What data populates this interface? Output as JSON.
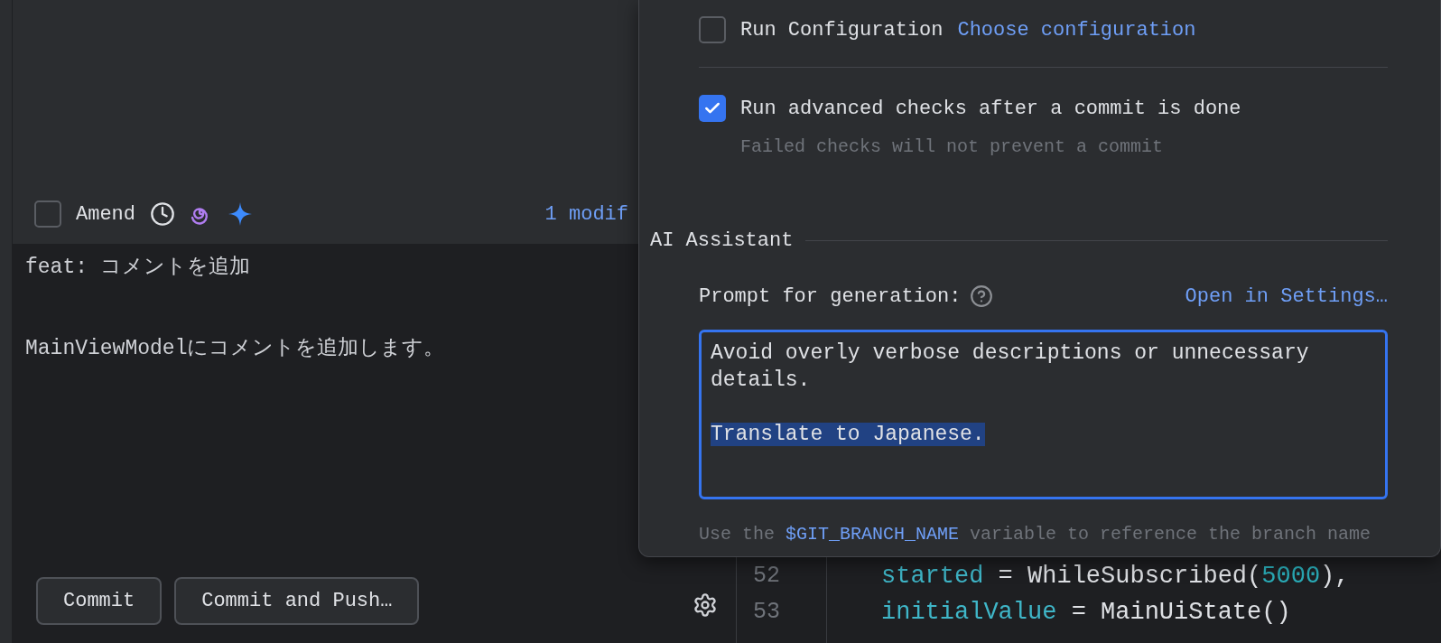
{
  "commit_panel": {
    "amend": {
      "label": "Amend",
      "checked": false
    },
    "changes_summary": "1 modif",
    "message": {
      "subject": "feat: コメントを追加",
      "body": "MainViewModelにコメントを追加します。"
    },
    "buttons": [
      "Commit",
      "Commit and Push…"
    ]
  },
  "editor": {
    "lines": [
      {
        "number": "52",
        "tokens": [
          {
            "kind": "property",
            "text": "started"
          },
          {
            "kind": "plain",
            "text": " = WhileSubscribed("
          },
          {
            "kind": "number",
            "text": "5000"
          },
          {
            "kind": "plain",
            "text": "),"
          }
        ]
      },
      {
        "number": "53",
        "tokens": [
          {
            "kind": "property",
            "text": "initialValue"
          },
          {
            "kind": "plain",
            "text": " = MainUiState()"
          }
        ]
      }
    ]
  },
  "options_popup": {
    "checks": [
      {
        "label": "Run Configuration",
        "checked": false,
        "link": "Choose configuration"
      },
      {
        "label": "Run advanced checks after a commit is done",
        "checked": true,
        "note": "Failed checks will not prevent a commit"
      }
    ],
    "ai_section": {
      "title": "AI Assistant",
      "prompt_label": "Prompt for generation:",
      "settings_link": "Open in Settings…",
      "prompt_text": "Avoid overly verbose descriptions or unnecessary\ndetails.\n\n",
      "prompt_selected_text": "Translate to Japanese.",
      "hint": {
        "before": "Use the ",
        "variable": "$GIT_BRANCH_NAME",
        "after": " variable to reference the branch name"
      }
    }
  }
}
